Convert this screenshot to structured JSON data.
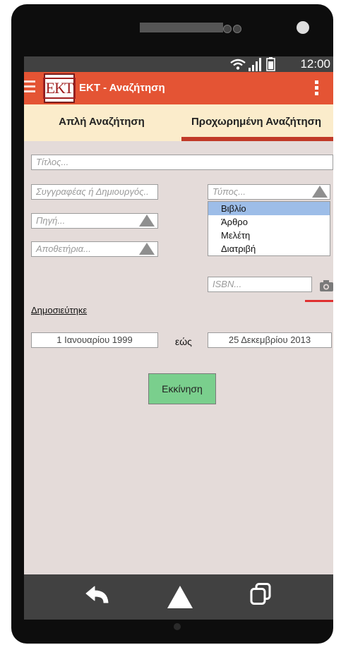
{
  "status": {
    "time": "12:00"
  },
  "app": {
    "title": "ΕΚΤ - Αναζήτηση",
    "logo_text": "ΕΚΤ"
  },
  "tabs": [
    {
      "label": "Απλή Αναζήτηση",
      "active": false
    },
    {
      "label": "Προχωρημένη Αναζήτηση",
      "active": true
    }
  ],
  "form": {
    "title_placeholder": "Τίτλος...",
    "author_placeholder": "Συγγραφέας ή Δημιουργός..",
    "type_placeholder": "Τύπος...",
    "type_options": [
      "Βιβλίο",
      "Άρθρο",
      "Μελέτη",
      "Διατριβή"
    ],
    "type_highlighted": "Βιβλίο",
    "source_placeholder": "Πηγή...",
    "repository_placeholder": "Αποθετήρια...",
    "isbn_placeholder": "ISBN...",
    "published_label": "Δημοσιεύτηκε",
    "date_from": "1 Ιανουαρίου 1999",
    "until_label": "εώς",
    "date_to": "25 Δεκεμβρίου 2013",
    "start_label": "Εκκίνηση"
  },
  "colors": {
    "appbar": "#e45434",
    "tabs_bg": "#fbeccb",
    "tab_indicator": "#c13a28",
    "screen_bg": "#e4dbd9",
    "start_button": "#7acf8d",
    "dropdown_highlight": "#9dbde8"
  },
  "icons": [
    "wifi-icon",
    "signal-icon",
    "battery-icon",
    "hamburger-icon",
    "overflow-menu-icon",
    "camera-icon",
    "back-icon",
    "home-icon",
    "recents-icon"
  ]
}
